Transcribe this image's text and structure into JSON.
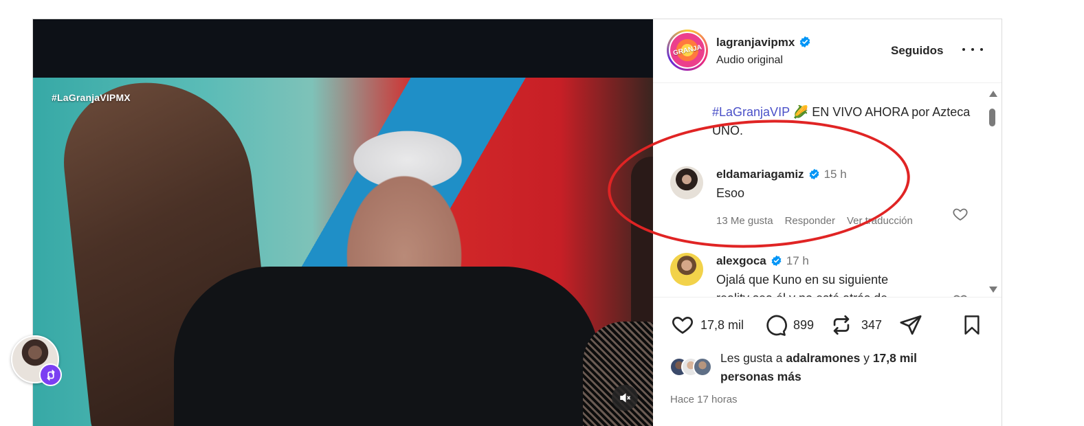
{
  "video": {
    "watermark": "#LaGranjaVIPMX",
    "mute_icon": "speaker-muted-icon"
  },
  "post": {
    "username": "lagranjavipmx",
    "avatar_text": "GRANJA",
    "subtitle": "Audio original",
    "follow_label": "Seguidos",
    "more_icon": "ellipsis-icon"
  },
  "caption": {
    "hashtag": "#LaGranjaVIP",
    "emoji": "🌽",
    "text": " EN VIVO AHORA por Azteca UNO."
  },
  "comments": [
    {
      "username": "eldamariagamiz",
      "time": "15 h",
      "text": "Esoo",
      "likes": "13 Me gusta",
      "reply": "Responder",
      "translate": "Ver traducción"
    },
    {
      "username": "alexgoca",
      "time": "17 h",
      "text": "Ojalá que Kuno en su siguiente",
      "text_cont": "reality sea él y no esté atrás de"
    }
  ],
  "actions": {
    "likes_count": "17,8 mil",
    "comments_count": "899",
    "reposts_count": "347"
  },
  "likes_summary": {
    "prefix": "Les gusta a ",
    "user": "adalramones",
    "middle": " y ",
    "count": "17,8 mil",
    "suffix": "personas más"
  },
  "time_ago": "Hace 17 horas",
  "colors": {
    "hashtag": "#4a50c8",
    "verified": "#0095f6",
    "annotation": "#e02424",
    "badge": "#7b3ff2"
  }
}
